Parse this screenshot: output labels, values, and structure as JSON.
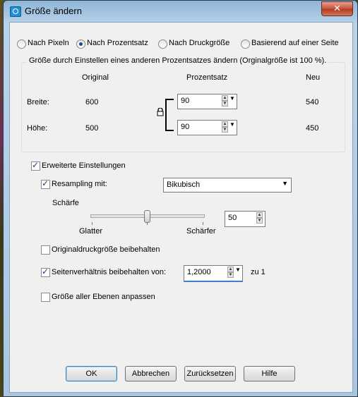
{
  "window": {
    "title": "Größe ändern",
    "close_symbol": "✕"
  },
  "mode": {
    "options": [
      "Nach Pixeln",
      "Nach Prozentsatz",
      "Nach Druckgröße",
      "Basierend auf einer Seite"
    ],
    "selected": "Nach Prozentsatz"
  },
  "group": {
    "caption": "Größe durch Einstellen eines anderen Prozentsatzes ändern (Orginalgröße ist 100 %).",
    "col_original": "Original",
    "col_percent": "Prozentsatz",
    "col_new": "Neu",
    "width_label": "Breite:",
    "width_original": "600",
    "width_percent": "90",
    "width_new": "540",
    "height_label": "Höhe:",
    "height_original": "500",
    "height_percent": "90",
    "height_new": "450"
  },
  "advanced": {
    "label": "Erweiterte Einstellungen",
    "checked": true,
    "resampling_label": "Resampling mit:",
    "resampling_checked": true,
    "resampling_value": "Bikubisch",
    "sharpness_label": "Schärfe",
    "sharpness_min_label": "Glatter",
    "sharpness_max_label": "Schärfer",
    "sharpness_value": "50",
    "sharpness_level": 0.5,
    "keep_print_label": "Originaldruckgröße beibehalten",
    "keep_print_checked": false,
    "aspect_label": "Seitenverhältnis beibehalten von:",
    "aspect_checked": true,
    "aspect_value": "1,2000",
    "aspect_suffix": "zu 1",
    "all_layers_label": "Größe aller Ebenen anpassen",
    "all_layers_checked": false
  },
  "buttons": {
    "ok": "OK",
    "cancel": "Abbrechen",
    "reset": "Zurücksetzen",
    "help": "Hilfe"
  },
  "icons": {
    "app": "camera-icon",
    "lock": "lock-icon"
  }
}
